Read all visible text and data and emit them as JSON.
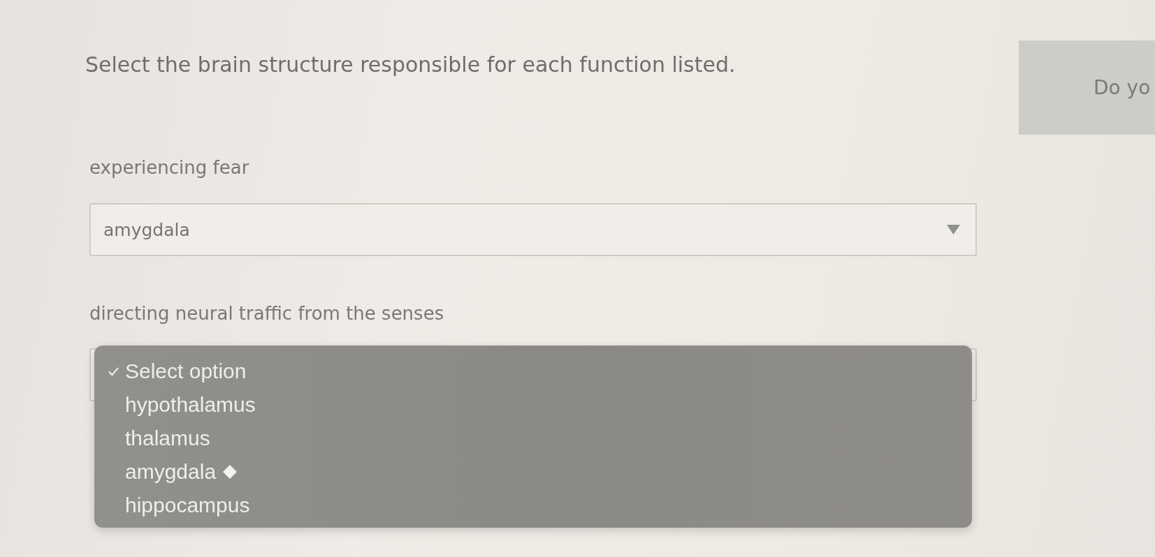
{
  "instruction": "Select the brain structure responsible for each function listed.",
  "side_panel": {
    "text": "Do yo"
  },
  "questions": [
    {
      "prompt": "experiencing fear",
      "dropdown": {
        "value": "amygdala",
        "expanded": false
      }
    },
    {
      "prompt": "directing neural traffic from the senses",
      "dropdown": {
        "expanded": true,
        "options": [
          {
            "label": "Select option",
            "selected": true,
            "marked": false
          },
          {
            "label": "hypothalamus",
            "selected": false,
            "marked": false
          },
          {
            "label": "thalamus",
            "selected": false,
            "marked": false
          },
          {
            "label": "amygdala",
            "selected": false,
            "marked": true
          },
          {
            "label": "hippocampus",
            "selected": false,
            "marked": false
          }
        ]
      }
    }
  ]
}
